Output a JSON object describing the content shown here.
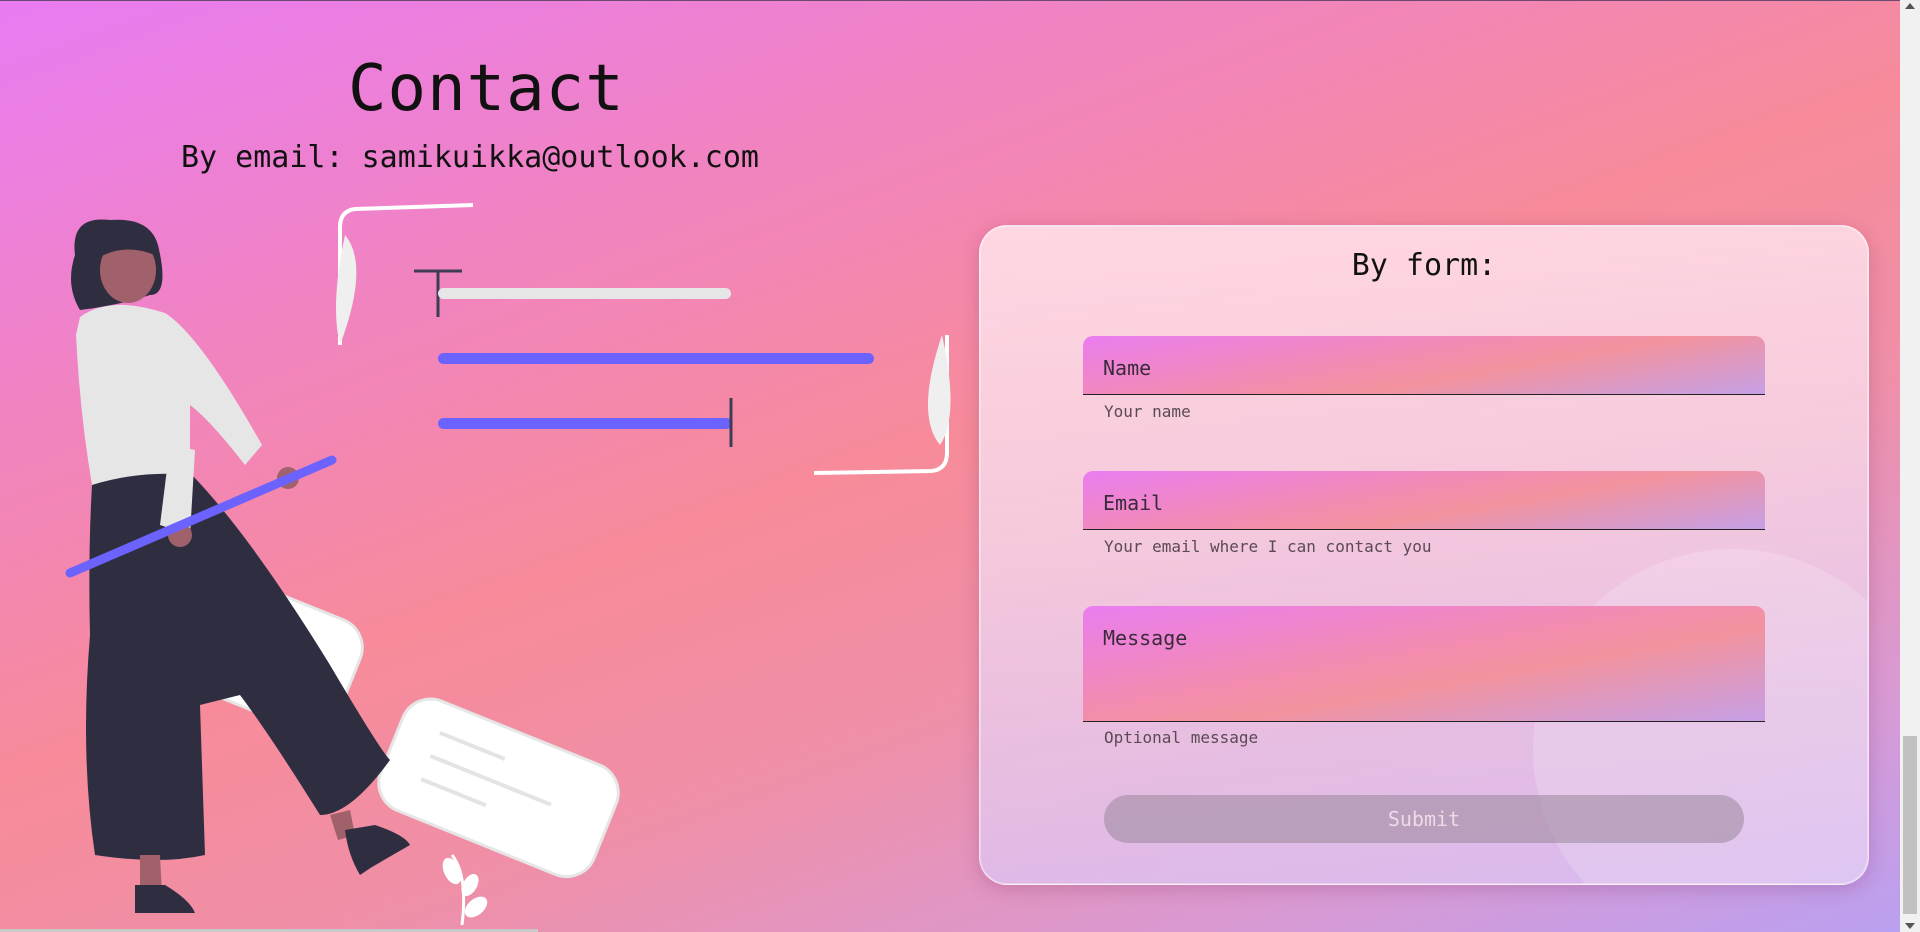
{
  "header": {
    "title": "Contact",
    "email_line": "By email: samikuikka@outlook.com"
  },
  "form": {
    "title": "By form:",
    "name_label": "Name",
    "name_help": "Your name",
    "email_label": "Email",
    "email_help": "Your email where I can contact you",
    "message_label": "Message",
    "message_help": "Optional message",
    "submit_label": "Submit"
  },
  "colors": {
    "accent": "#6c63ff",
    "figure_dark": "#2f2e41",
    "skin": "#a0616a"
  },
  "icons": {
    "illustration": "contact-person-illustration"
  }
}
